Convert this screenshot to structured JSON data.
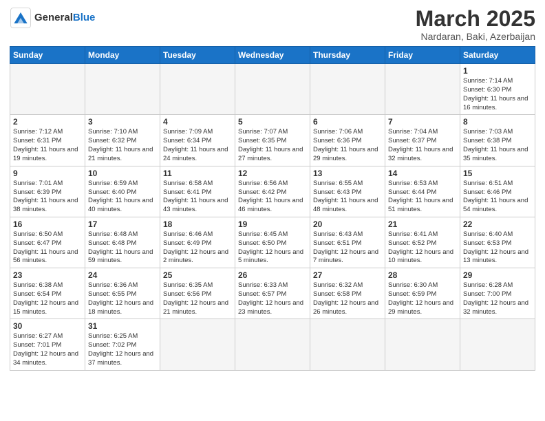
{
  "logo": {
    "text_general": "General",
    "text_blue": "Blue"
  },
  "header": {
    "month_year": "March 2025",
    "location": "Nardaran, Baki, Azerbaijan"
  },
  "weekdays": [
    "Sunday",
    "Monday",
    "Tuesday",
    "Wednesday",
    "Thursday",
    "Friday",
    "Saturday"
  ],
  "weeks": [
    [
      {
        "day": "",
        "info": ""
      },
      {
        "day": "",
        "info": ""
      },
      {
        "day": "",
        "info": ""
      },
      {
        "day": "",
        "info": ""
      },
      {
        "day": "",
        "info": ""
      },
      {
        "day": "",
        "info": ""
      },
      {
        "day": "1",
        "info": "Sunrise: 7:14 AM\nSunset: 6:30 PM\nDaylight: 11 hours and 16 minutes."
      }
    ],
    [
      {
        "day": "2",
        "info": "Sunrise: 7:12 AM\nSunset: 6:31 PM\nDaylight: 11 hours and 19 minutes."
      },
      {
        "day": "3",
        "info": "Sunrise: 7:10 AM\nSunset: 6:32 PM\nDaylight: 11 hours and 21 minutes."
      },
      {
        "day": "4",
        "info": "Sunrise: 7:09 AM\nSunset: 6:34 PM\nDaylight: 11 hours and 24 minutes."
      },
      {
        "day": "5",
        "info": "Sunrise: 7:07 AM\nSunset: 6:35 PM\nDaylight: 11 hours and 27 minutes."
      },
      {
        "day": "6",
        "info": "Sunrise: 7:06 AM\nSunset: 6:36 PM\nDaylight: 11 hours and 29 minutes."
      },
      {
        "day": "7",
        "info": "Sunrise: 7:04 AM\nSunset: 6:37 PM\nDaylight: 11 hours and 32 minutes."
      },
      {
        "day": "8",
        "info": "Sunrise: 7:03 AM\nSunset: 6:38 PM\nDaylight: 11 hours and 35 minutes."
      }
    ],
    [
      {
        "day": "9",
        "info": "Sunrise: 7:01 AM\nSunset: 6:39 PM\nDaylight: 11 hours and 38 minutes."
      },
      {
        "day": "10",
        "info": "Sunrise: 6:59 AM\nSunset: 6:40 PM\nDaylight: 11 hours and 40 minutes."
      },
      {
        "day": "11",
        "info": "Sunrise: 6:58 AM\nSunset: 6:41 PM\nDaylight: 11 hours and 43 minutes."
      },
      {
        "day": "12",
        "info": "Sunrise: 6:56 AM\nSunset: 6:42 PM\nDaylight: 11 hours and 46 minutes."
      },
      {
        "day": "13",
        "info": "Sunrise: 6:55 AM\nSunset: 6:43 PM\nDaylight: 11 hours and 48 minutes."
      },
      {
        "day": "14",
        "info": "Sunrise: 6:53 AM\nSunset: 6:44 PM\nDaylight: 11 hours and 51 minutes."
      },
      {
        "day": "15",
        "info": "Sunrise: 6:51 AM\nSunset: 6:46 PM\nDaylight: 11 hours and 54 minutes."
      }
    ],
    [
      {
        "day": "16",
        "info": "Sunrise: 6:50 AM\nSunset: 6:47 PM\nDaylight: 11 hours and 56 minutes."
      },
      {
        "day": "17",
        "info": "Sunrise: 6:48 AM\nSunset: 6:48 PM\nDaylight: 11 hours and 59 minutes."
      },
      {
        "day": "18",
        "info": "Sunrise: 6:46 AM\nSunset: 6:49 PM\nDaylight: 12 hours and 2 minutes."
      },
      {
        "day": "19",
        "info": "Sunrise: 6:45 AM\nSunset: 6:50 PM\nDaylight: 12 hours and 5 minutes."
      },
      {
        "day": "20",
        "info": "Sunrise: 6:43 AM\nSunset: 6:51 PM\nDaylight: 12 hours and 7 minutes."
      },
      {
        "day": "21",
        "info": "Sunrise: 6:41 AM\nSunset: 6:52 PM\nDaylight: 12 hours and 10 minutes."
      },
      {
        "day": "22",
        "info": "Sunrise: 6:40 AM\nSunset: 6:53 PM\nDaylight: 12 hours and 13 minutes."
      }
    ],
    [
      {
        "day": "23",
        "info": "Sunrise: 6:38 AM\nSunset: 6:54 PM\nDaylight: 12 hours and 15 minutes."
      },
      {
        "day": "24",
        "info": "Sunrise: 6:36 AM\nSunset: 6:55 PM\nDaylight: 12 hours and 18 minutes."
      },
      {
        "day": "25",
        "info": "Sunrise: 6:35 AM\nSunset: 6:56 PM\nDaylight: 12 hours and 21 minutes."
      },
      {
        "day": "26",
        "info": "Sunrise: 6:33 AM\nSunset: 6:57 PM\nDaylight: 12 hours and 23 minutes."
      },
      {
        "day": "27",
        "info": "Sunrise: 6:32 AM\nSunset: 6:58 PM\nDaylight: 12 hours and 26 minutes."
      },
      {
        "day": "28",
        "info": "Sunrise: 6:30 AM\nSunset: 6:59 PM\nDaylight: 12 hours and 29 minutes."
      },
      {
        "day": "29",
        "info": "Sunrise: 6:28 AM\nSunset: 7:00 PM\nDaylight: 12 hours and 32 minutes."
      }
    ],
    [
      {
        "day": "30",
        "info": "Sunrise: 6:27 AM\nSunset: 7:01 PM\nDaylight: 12 hours and 34 minutes."
      },
      {
        "day": "31",
        "info": "Sunrise: 6:25 AM\nSunset: 7:02 PM\nDaylight: 12 hours and 37 minutes."
      },
      {
        "day": "",
        "info": ""
      },
      {
        "day": "",
        "info": ""
      },
      {
        "day": "",
        "info": ""
      },
      {
        "day": "",
        "info": ""
      },
      {
        "day": "",
        "info": ""
      }
    ]
  ]
}
